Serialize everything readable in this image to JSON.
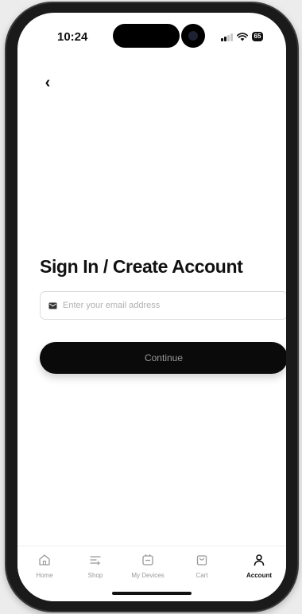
{
  "status_bar": {
    "time": "10:24",
    "battery": "65"
  },
  "header": {
    "back_icon": "back-chevron-icon",
    "back_glyph": "‹"
  },
  "main": {
    "title": "Sign In / Create Account",
    "email": {
      "placeholder": "Enter your email address",
      "value": "",
      "icon": "mail-icon"
    },
    "continue_label": "Continue"
  },
  "tab_bar": {
    "active": "Account",
    "items": [
      {
        "label": "Home",
        "icon": "home-icon"
      },
      {
        "label": "Shop",
        "icon": "shop-icon"
      },
      {
        "label": "My Devices",
        "icon": "devices-icon"
      },
      {
        "label": "Cart",
        "icon": "cart-icon"
      },
      {
        "label": "Account",
        "icon": "person-icon"
      }
    ]
  },
  "colors": {
    "primary": "#0a0a0a",
    "background": "#ffffff",
    "muted": "#999999"
  }
}
